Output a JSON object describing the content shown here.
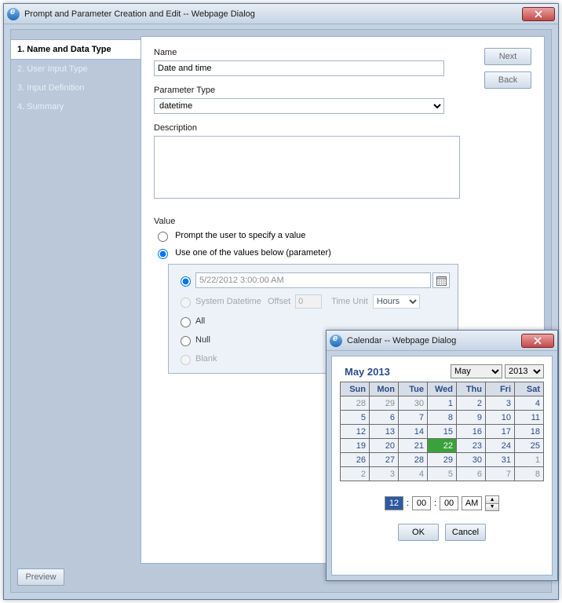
{
  "window": {
    "title": "Prompt and Parameter Creation and Edit -- Webpage Dialog"
  },
  "sidebar": {
    "steps": [
      {
        "label": "1. Name and Data Type",
        "active": true
      },
      {
        "label": "2. User Input Type",
        "active": false
      },
      {
        "label": "3. Input Definition",
        "active": false
      },
      {
        "label": "4. Summary",
        "active": false
      }
    ]
  },
  "buttons": {
    "next": "Next",
    "back": "Back",
    "preview": "Preview"
  },
  "form": {
    "name_label": "Name",
    "name_value": "Date and time",
    "paramtype_label": "Parameter Type",
    "paramtype_value": "datetime",
    "description_label": "Description",
    "description_value": "",
    "value_label": "Value",
    "value_mode": "preset",
    "radio_prompt": "Prompt the user to specify a value",
    "radio_preset": "Use one of the values below (parameter)",
    "preset": {
      "datetime_value": "5/22/2012 3:00:00 AM",
      "system_label": "System Datetime",
      "offset_label": "Offset",
      "offset_value": "0",
      "timeunit_label": "Time Unit",
      "timeunit_value": "Hours",
      "all_label": "All",
      "null_label": "Null",
      "blank_label": "Blank"
    }
  },
  "calendar": {
    "window_title": "Calendar -- Webpage Dialog",
    "month_year_display": "May 2013",
    "month_select": "May",
    "year_select": "2013",
    "dow": [
      "Sun",
      "Mon",
      "Tue",
      "Wed",
      "Thu",
      "Fri",
      "Sat"
    ],
    "grid": [
      [
        {
          "d": 28,
          "o": true
        },
        {
          "d": 29,
          "o": true
        },
        {
          "d": 30,
          "o": true
        },
        {
          "d": 1
        },
        {
          "d": 2
        },
        {
          "d": 3
        },
        {
          "d": 4
        }
      ],
      [
        {
          "d": 5
        },
        {
          "d": 6
        },
        {
          "d": 7
        },
        {
          "d": 8
        },
        {
          "d": 9
        },
        {
          "d": 10
        },
        {
          "d": 11
        }
      ],
      [
        {
          "d": 12
        },
        {
          "d": 13
        },
        {
          "d": 14
        },
        {
          "d": 15
        },
        {
          "d": 16
        },
        {
          "d": 17
        },
        {
          "d": 18
        }
      ],
      [
        {
          "d": 19
        },
        {
          "d": 20
        },
        {
          "d": 21
        },
        {
          "d": 22,
          "sel": true
        },
        {
          "d": 23
        },
        {
          "d": 24
        },
        {
          "d": 25
        }
      ],
      [
        {
          "d": 26
        },
        {
          "d": 27
        },
        {
          "d": 28
        },
        {
          "d": 29
        },
        {
          "d": 30
        },
        {
          "d": 31
        },
        {
          "d": 1,
          "o": true
        }
      ],
      [
        {
          "d": 2,
          "o": true
        },
        {
          "d": 3,
          "o": true
        },
        {
          "d": 4,
          "o": true
        },
        {
          "d": 5,
          "o": true
        },
        {
          "d": 6,
          "o": true
        },
        {
          "d": 7,
          "o": true
        },
        {
          "d": 8,
          "o": true
        }
      ]
    ],
    "time": {
      "hh": "12",
      "mm": "00",
      "ss": "00",
      "ampm": "AM"
    },
    "ok": "OK",
    "cancel": "Cancel",
    "colon": ":"
  }
}
